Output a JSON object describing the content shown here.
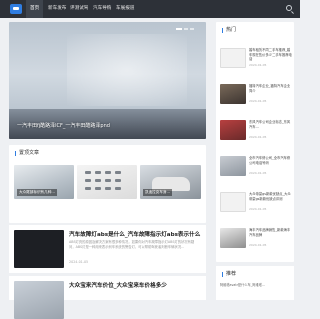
{
  "nav": {
    "items": [
      "首页",
      "新车发布",
      "评测试驾",
      "汽车导购",
      "车展报道"
    ]
  },
  "banner": {
    "title": "一汽丰田fj酷路泽lCF_一汽丰田酷路泽pnd"
  },
  "section1": {
    "title": "置顶文章",
    "thumbs": [
      {
        "caption": "大众尾部标识有几种…"
      },
      {
        "caption": ""
      },
      {
        "caption": "凯迪拉克车身…"
      }
    ]
  },
  "articles": [
    {
      "title": "汽车故障灯abs是什么_汽车故障指示灯abs表示什么",
      "desc": "ABS灯亮的原因及解决方案有很多种情况，如果你对汽车故障指示灯ABS灯的状况有疑问，ABS灯是一种用来表示刹车系统的警告灯，可以帮助驾驶者判断车辆状况...",
      "meta": "2024-01-05"
    },
    {
      "title": "大众宝来汽车价位_大众宝来车价格多少",
      "desc": "",
      "meta": ""
    }
  ],
  "sidebar": {
    "title": "热门",
    "items": [
      {
        "title": "婚车租赁不同二手车推荐_婚车现在售价多少二手车推荐电话",
        "date": "2024-01-05"
      },
      {
        "title": "福特汽车企业_福特汽车企业简介",
        "date": "2024-01-05"
      },
      {
        "title": "东风汽车公司企业标志_东风汽车...",
        "date": "2024-01-05"
      },
      {
        "title": "全市汽车修公司_全市汽车修公司电话号码",
        "date": "2024-01-05"
      },
      {
        "title": "大众帝豪gs新款优缺点_大众帝豪gs新款优缺点评测",
        "date": "2024-01-05"
      },
      {
        "title": "海丰汽车品牌销售_新款海丰汽车品牌",
        "date": "2024-01-05"
      }
    ]
  },
  "sidebar2": {
    "title": "推荐",
    "item": "阿维塔avatr是什么车_阿维塔..."
  }
}
